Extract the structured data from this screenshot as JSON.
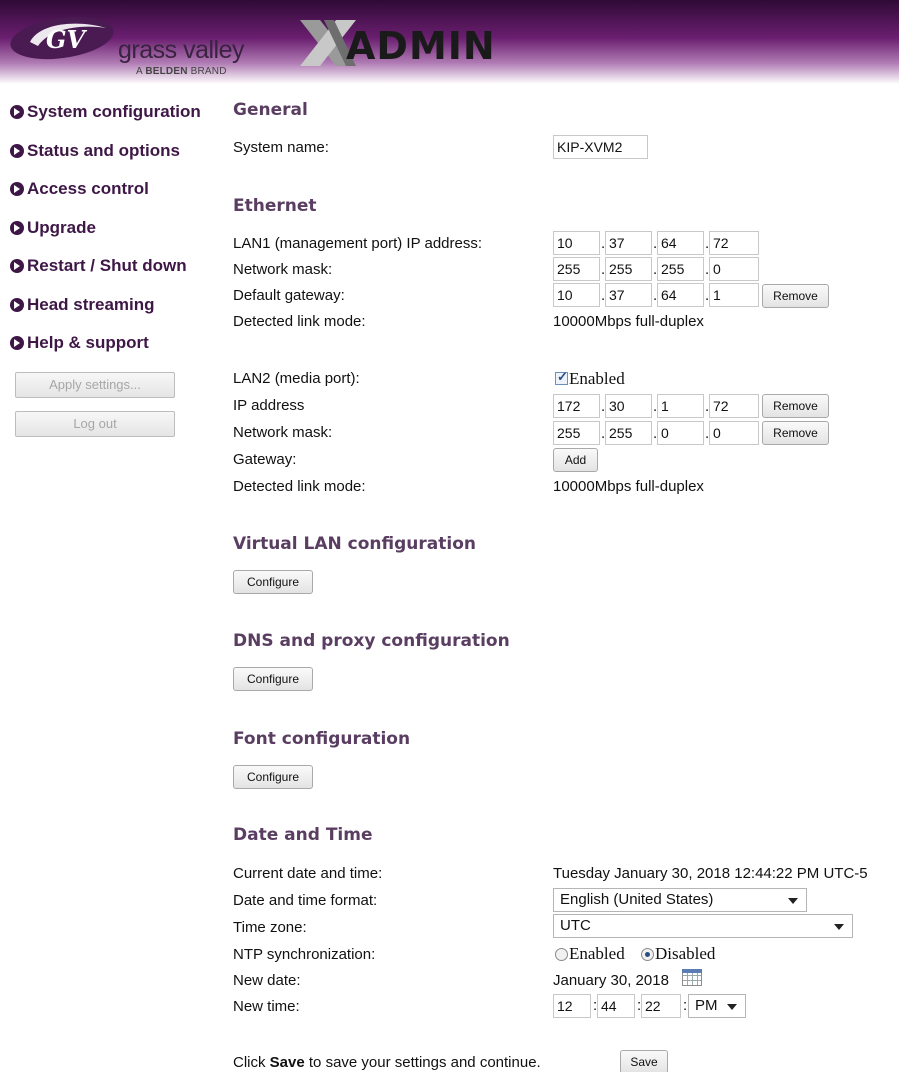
{
  "brand": {
    "logo_name": "grass valley",
    "logo_sub_prefix": "A",
    "logo_sub_bold": "BELDEN",
    "logo_sub_suffix": "BRAND",
    "app_name": "ADMIN",
    "colors": {
      "header_dark": "#2f0a36",
      "nav": "#3e1747",
      "section": "#5a3e62"
    }
  },
  "sidebar": {
    "items": [
      {
        "label": "System configuration",
        "icon": "chevron-right-circle-icon"
      },
      {
        "label": "Status and options",
        "icon": "chevron-right-circle-icon"
      },
      {
        "label": "Access control",
        "icon": "chevron-right-circle-icon"
      },
      {
        "label": "Upgrade",
        "icon": "chevron-right-circle-icon"
      },
      {
        "label": "Restart / Shut down",
        "icon": "chevron-right-circle-icon"
      },
      {
        "label": "Head streaming",
        "icon": "chevron-right-circle-icon"
      },
      {
        "label": "Help & support",
        "icon": "chevron-right-circle-icon"
      }
    ],
    "apply_label": "Apply settings...",
    "logout_label": "Log out"
  },
  "general": {
    "title": "General",
    "system_name_label": "System name:",
    "system_name_value": "KIP-XVM2"
  },
  "ethernet": {
    "title": "Ethernet",
    "lan1_ip_label": "LAN1 (management port) IP address:",
    "lan1_ip": [
      "10",
      "37",
      "64",
      "72"
    ],
    "lan1_mask_label": "Network mask:",
    "lan1_mask": [
      "255",
      "255",
      "255",
      "0"
    ],
    "lan1_gw_label": "Default gateway:",
    "lan1_gw": [
      "10",
      "37",
      "64",
      "1"
    ],
    "remove_label": "Remove",
    "lan1_link_label": "Detected link mode:",
    "lan1_link_value": "10000Mbps full-duplex",
    "lan2_label": "LAN2 (media port):",
    "lan2_enabled_label": "Enabled",
    "lan2_enabled": true,
    "lan2_ip_label": "IP address",
    "lan2_ip": [
      "172",
      "30",
      "1",
      "72"
    ],
    "lan2_mask_label": "Network mask:",
    "lan2_mask": [
      "255",
      "255",
      "0",
      "0"
    ],
    "lan2_gw_label": "Gateway:",
    "add_label": "Add",
    "lan2_link_label": "Detected link mode:",
    "lan2_link_value": "10000Mbps full-duplex"
  },
  "vlan": {
    "title": "Virtual LAN configuration",
    "button": "Configure"
  },
  "dns": {
    "title": "DNS and proxy configuration",
    "button": "Configure"
  },
  "font": {
    "title": "Font configuration",
    "button": "Configure"
  },
  "datetime": {
    "title": "Date and Time",
    "current_label": "Current date and time:",
    "current_value": "Tuesday January 30, 2018 12:44:22 PM UTC-5",
    "format_label": "Date and time format:",
    "format_value": "English (United States)",
    "tz_label": "Time zone:",
    "tz_value": "UTC",
    "ntp_label": "NTP synchronization:",
    "ntp_enabled_label": "Enabled",
    "ntp_disabled_label": "Disabled",
    "ntp_selected": "Disabled",
    "new_date_label": "New date:",
    "new_date_value": "January 30, 2018",
    "new_time_label": "New time:",
    "hour": "12",
    "minute": "44",
    "second": "22",
    "ampm": "PM"
  },
  "footer": {
    "prefix": "Click ",
    "bold": "Save",
    "suffix": " to save your settings and continue.",
    "save_label": "Save"
  }
}
